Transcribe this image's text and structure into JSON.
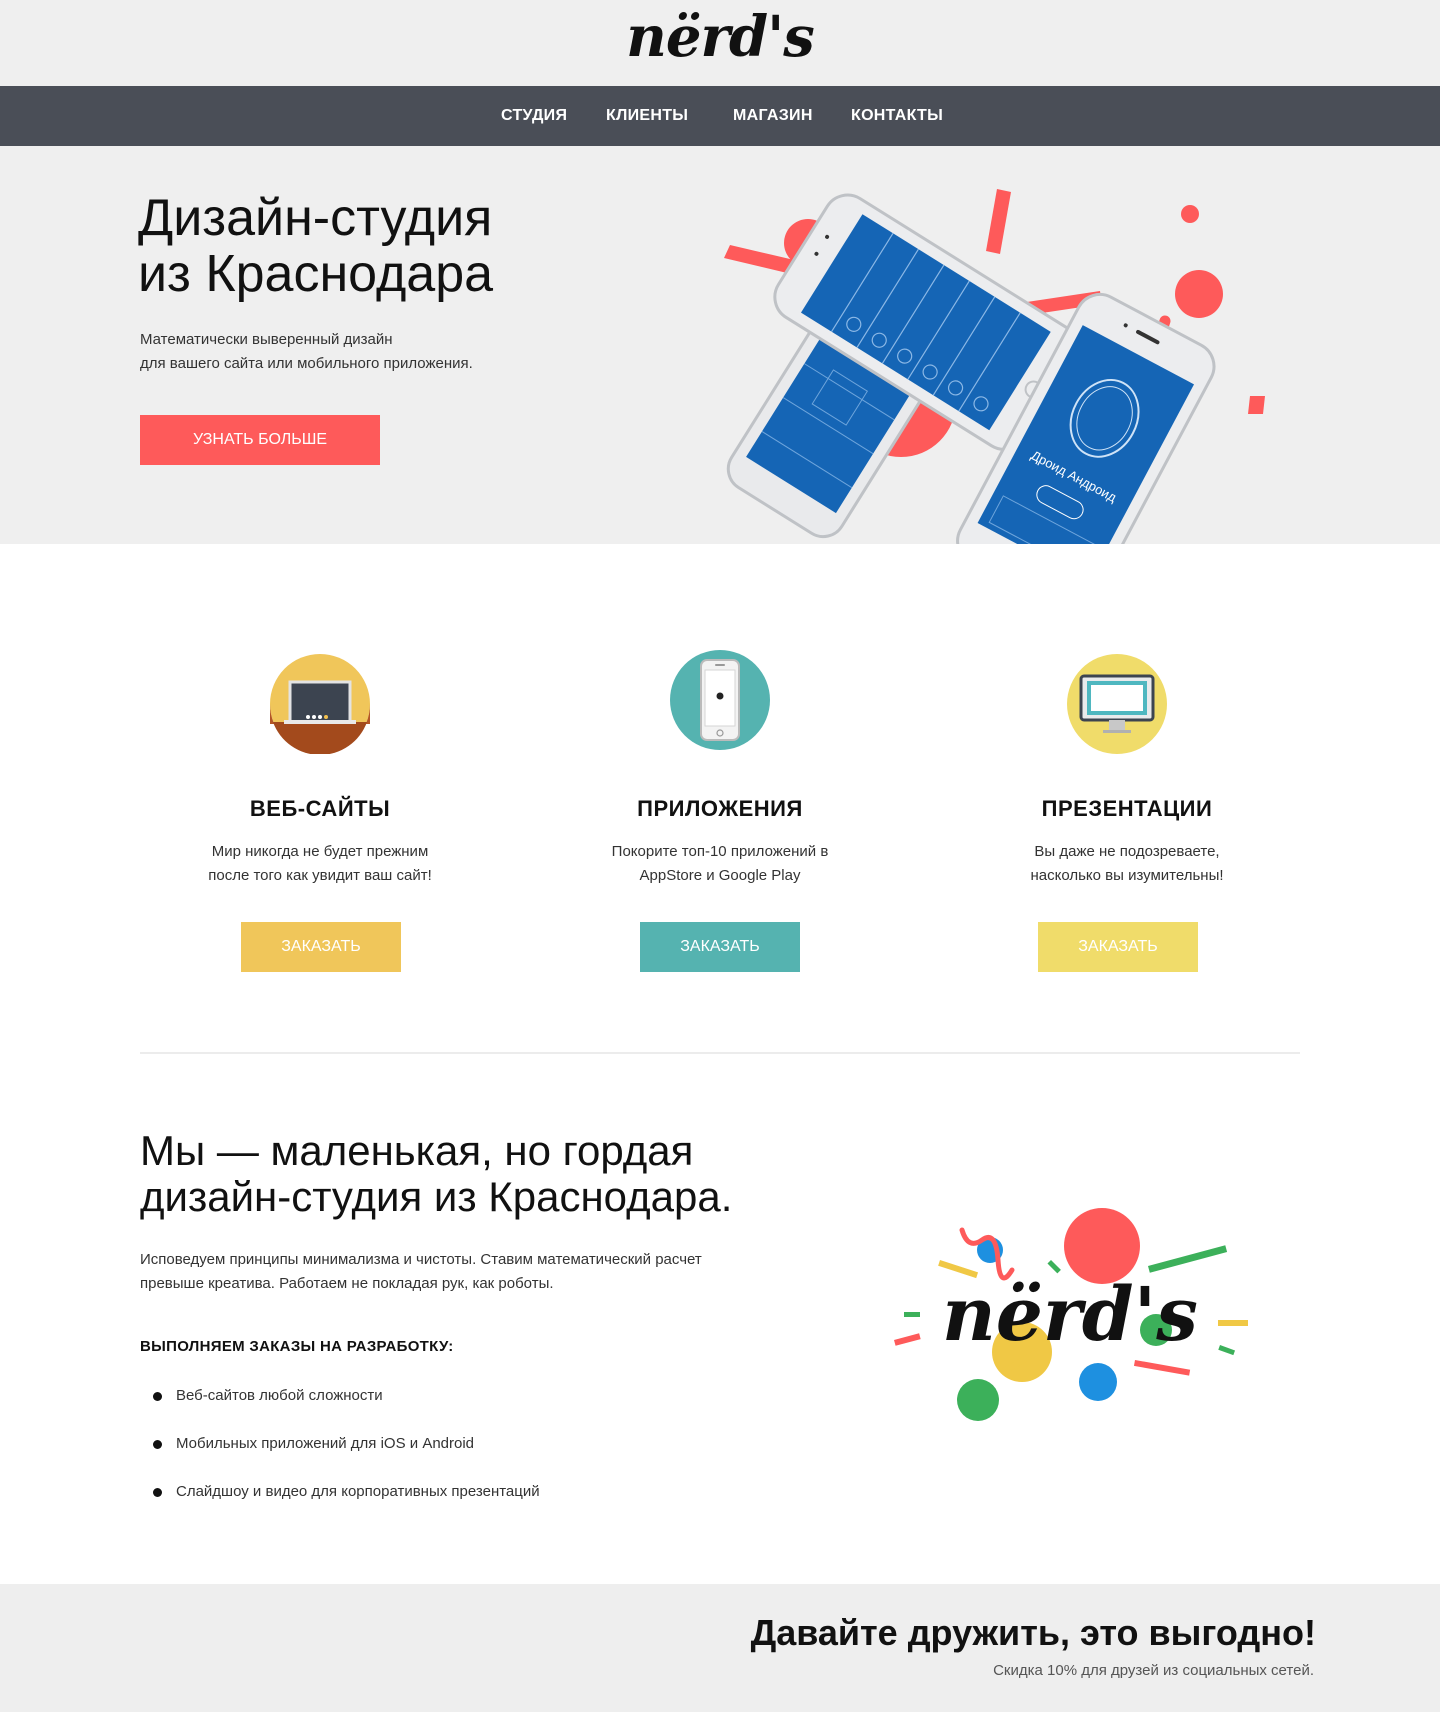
{
  "header": {
    "logo_text": "nërd's"
  },
  "nav": {
    "items": [
      {
        "label": "СТУДИЯ"
      },
      {
        "label": "КЛИЕНТЫ"
      },
      {
        "label": "МАГАЗИН"
      },
      {
        "label": "КОНТАКТЫ"
      }
    ]
  },
  "hero": {
    "title_line1": "Дизайн-студия",
    "title_line2": "из Краснодара",
    "subtitle_line1": "Математически выверенный дизайн",
    "subtitle_line2": "для вашего сайта или мобильного приложения.",
    "button_label": "УЗНАТЬ БОЛЬШЕ",
    "phone_app_title": "Дроид Андроид"
  },
  "services": [
    {
      "title": "ВЕБ-САЙТЫ",
      "desc_line1": "Мир никогда не будет прежним",
      "desc_line2": "после того как увидит ваш сайт!",
      "button_label": "ЗАКАЗАТЬ",
      "icon": "blackboard-icon",
      "color": "#f0c65a"
    },
    {
      "title": "ПРИЛОЖЕНИЯ",
      "desc_line1": "Покорите топ-10 приложений в",
      "desc_line2": "AppStore и Google Play",
      "button_label": "ЗАКАЗАТЬ",
      "icon": "smartphone-icon",
      "color": "#55b3b0"
    },
    {
      "title": "ПРЕЗЕНТАЦИИ",
      "desc_line1": "Вы даже не подозреваете,",
      "desc_line2": "насколько вы изумительны!",
      "button_label": "ЗАКАЗАТЬ",
      "icon": "monitor-icon",
      "color": "#f0dc6a"
    }
  ],
  "about": {
    "title_line1": "Мы — маленькая, но гордая",
    "title_line2": "дизайн-студия из Краснодара.",
    "text_line1": "Исповедуем принципы минимализма и чистоты. Ставим математический расчет",
    "text_line2": "превыше креатива. Работаем не покладая рук, как роботы.",
    "subtitle": "ВЫПОЛНЯЕМ ЗАКАЗЫ НА РАЗРАБОТКУ:",
    "list": [
      "Веб-сайтов любой сложности",
      "Мобильных приложений для iOS и Android",
      "Слайдшоу и видео для корпоративных презентаций"
    ],
    "logo_text": "nërd's"
  },
  "footer": {
    "title": "Давайте дружить, это выгодно!",
    "subtitle": "Скидка 10% для друзей из социальных сетей."
  },
  "colors": {
    "accent_red": "#fe5a5a",
    "nav_bg": "#4a4e57",
    "phone_screen": "#1565b5"
  }
}
